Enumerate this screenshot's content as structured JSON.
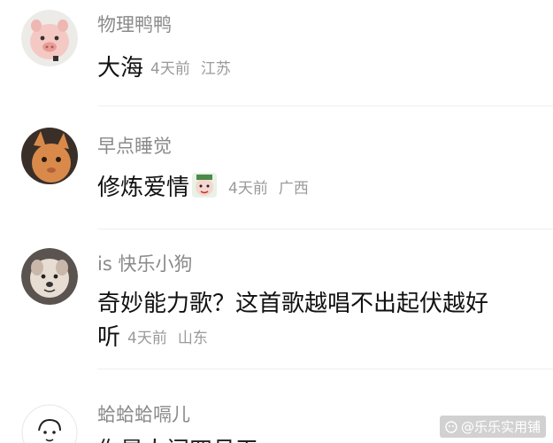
{
  "comments": [
    {
      "username": "物理鸭鸭",
      "text": "大海",
      "time": "4天前",
      "location": "江苏",
      "avatar": "pig-avatar-icon"
    },
    {
      "username": "早点睡觉",
      "text": "修炼爱情",
      "emoji": "sticker-emoji-icon",
      "time": "4天前",
      "location": "广西",
      "avatar": "cat-avatar-icon"
    },
    {
      "username": "is 快乐小狗",
      "text_line1": "奇妙能力歌？这首歌越唱不出起伏越好",
      "text_line2": "听",
      "time": "4天前",
      "location": "山东",
      "avatar": "dog-avatar-icon"
    },
    {
      "username": "蛤蛤蛤嗝儿",
      "text_partial": "你是人间四月天",
      "avatar": "sketch-avatar-icon"
    }
  ],
  "watermark": "@乐乐实用铺"
}
